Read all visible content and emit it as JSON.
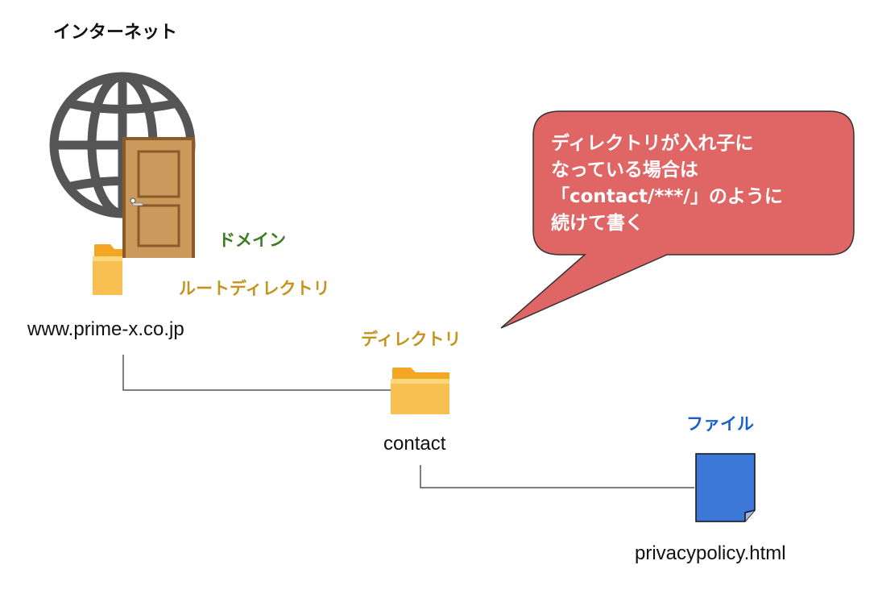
{
  "title": "インターネット",
  "labels": {
    "domain": "ドメイン",
    "root_directory": "ルートディレクトリ",
    "directory": "ディレクトリ",
    "file": "ファイル"
  },
  "names": {
    "domain": "www.prime-x.co.jp",
    "directory": "contact",
    "file": "privacypolicy.html"
  },
  "callout": {
    "lines": [
      "ディレクトリが入れ子に",
      "なっている場合は",
      "「contact/***/」のように",
      "続けて書く"
    ]
  },
  "icons": [
    "globe-icon",
    "door-icon",
    "folder-icon",
    "file-icon"
  ],
  "colors": {
    "domain_label": "#3a7d22",
    "directory_label": "#c4941c",
    "file_label": "#1a5fc8",
    "callout_fill": "#e06666",
    "file_icon": "#3c78d8",
    "folder": "#f6b93b"
  }
}
